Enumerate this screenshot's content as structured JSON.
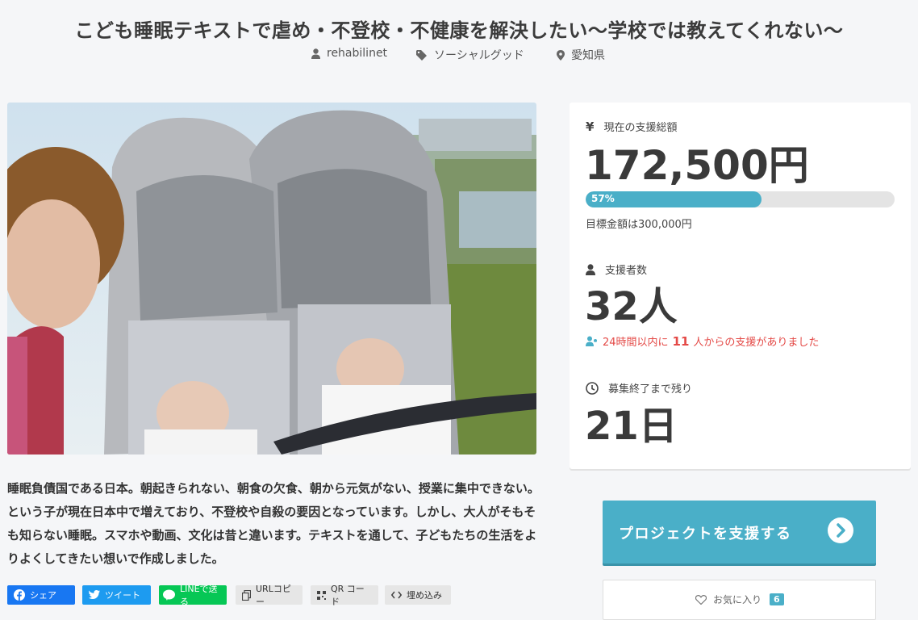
{
  "project": {
    "title": "こども睡眠テキストで虐め・不登校・不健康を解決したい〜学校では教えてくれない〜",
    "owner": "rehabilinet",
    "category": "ソーシャルグッド",
    "location": "愛知県",
    "description": "睡眠負債国である日本。朝起きられない、朝食の欠食、朝から元気がない、授業に集中できない。という子が現在日本中で増えており、不登校や自殺の要因となっています。しかし、大人がそもそも知らない睡眠。スマホや動画、文化は昔と違います。テキストを通して、子どもたちの生活をよりよくしてきたい想いで作成しました。"
  },
  "share": {
    "facebook": "シェア",
    "twitter": "ツイート",
    "line": "LINEで送る",
    "url_copy": "URLコピー",
    "qr": "QR コード",
    "embed": "埋め込み"
  },
  "stats": {
    "amount_label": "現在の支援総額",
    "amount": "172,500円",
    "progress": 0.57,
    "progress_label": "57%",
    "goal": "目標金額は300,000円",
    "backers_label": "支援者数",
    "backers": "32人",
    "recent_prefix": "24時間以内に",
    "recent_count": "11",
    "recent_suffix": "人からの支援がありました",
    "remaining_label": "募集終了まで残り",
    "remaining": "21日"
  },
  "actions": {
    "support": "プロジェクトを支援する",
    "favorite": "お気に入り",
    "favorite_count": "6"
  },
  "colors": {
    "accent": "#4aafc8",
    "alert": "#e44a47",
    "facebook": "#1877f2",
    "twitter": "#1d9bf0",
    "line": "#06c755"
  }
}
